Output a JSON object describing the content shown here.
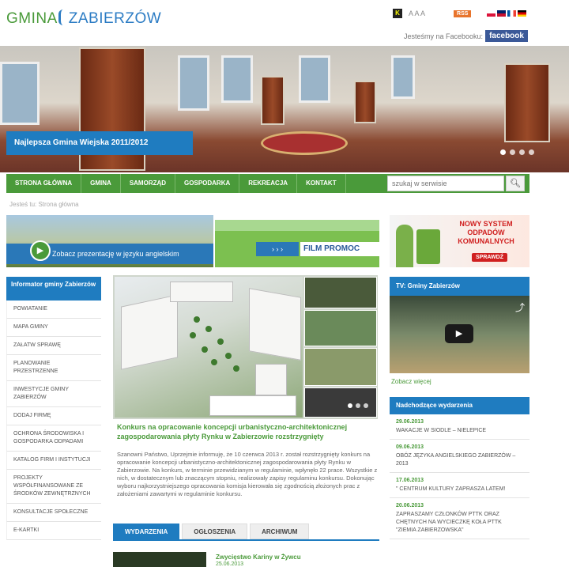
{
  "header": {
    "logo_gmina": "GMINA",
    "logo_name": "ZABIERZÓW",
    "contrast_label": "K",
    "font_size_label": "A A A",
    "rss_label": "RSS",
    "facebook_prompt": "Jesteśmy na Facebooku:",
    "facebook_label": "facebook",
    "flags": [
      {
        "name": "polish-flag-icon",
        "colors": [
          "#ffffff",
          "#dc143c"
        ]
      },
      {
        "name": "english-flag-icon",
        "colors": [
          "#012169",
          "#c8102e"
        ]
      },
      {
        "name": "french-flag-icon",
        "colors": [
          "#0055a4",
          "#ffffff",
          "#ef4135"
        ]
      },
      {
        "name": "german-flag-icon",
        "colors": [
          "#000000",
          "#dd0000",
          "#ffce00"
        ]
      }
    ]
  },
  "hero": {
    "caption": "Najlepsza Gmina Wiejska 2011/2012",
    "slide_count": 4,
    "active_slide": 1
  },
  "nav": {
    "items": [
      "STRONA GŁÓWNA",
      "GMINA",
      "SAMORZĄD",
      "GOSPODARKA",
      "REKREACJA",
      "KONTAKT"
    ],
    "search_placeholder": "szukaj w serwisie"
  },
  "breadcrumb": "Jesteś tu: Strona główna",
  "banners": {
    "presentation": "Zobacz prezentację w języku angielskim",
    "film_arrows": "› › ›",
    "film_label": "FILM PROMOC",
    "waste_text": "NOWY SYSTEM ODPADÓW KOMUNALNYCH",
    "waste_button": "SPRAWDŹ"
  },
  "sidebar": {
    "title": "Informator gminy Zabierzów",
    "items": [
      "POWIATANIE",
      "MAPA GMINY",
      "ZAŁATW SPRAWĘ",
      "PLANOWANIE PRZESTRZENNE",
      "INWESTYCJE GMINY ZABIERZÓW",
      "DODAJ FIRMĘ",
      "OCHRONA ŚRODOWISKA I GOSPODARKA ODPADAMI",
      "KATALOG FIRM I INSTYTUCJI",
      "PROJEKTY WSPÓŁFINANSOWANE ZE ŚRODKÓW ZEWNĘTRZNYCH",
      "KONSULTACJE SPOŁECZNE",
      "E-KARTKI"
    ]
  },
  "feature": {
    "title": "Konkurs na opracowanie koncepcji urbanistyczno-architektonicznej zagospodarowania płyty Rynku w Zabierzowie rozstrzygnięty",
    "text": "Szanowni Państwo, Uprzejmie informuję, że 10 czerwca 2013 r. został rozstrzygnięty konkurs na opracowanie koncepcji urbanistyczno-architektonicznej zagospodarowania płyty Rynku w Zabierzowie. Na konkurs, w terminie przewidzianym w regulaminie, wpłynęło 22 prace. Wszystkie z nich, w dostatecznym lub znaczącym stopniu, realizowały zapisy regulaminu konkursu. Dokonując wyboru najkorzystniejszego opracowania komisja kierowała się zgodnością złożonych prac z założeniami zawartymi w regulaminie konkursu.",
    "slide_count": 3,
    "active_slide": 1
  },
  "tabs": [
    "WYDARZENIA",
    "OGŁOSZENIA",
    "ARCHIWUM"
  ],
  "news": {
    "title": "Zwycięstwo Kariny w Żywcu",
    "date": "25.06.2013"
  },
  "tv": {
    "title": "TV: Gminy Zabierzów",
    "more": "Zobacz więcej"
  },
  "events": {
    "title": "Nadchodzące wydarzenia",
    "items": [
      {
        "date": "29.06.2013",
        "title": "WAKACJE W SIODLE – NIELEPICE"
      },
      {
        "date": "09.06.2013",
        "title": "OBÓZ JĘZYKA ANGIELSKIEGO ZABIERZÓW – 2013"
      },
      {
        "date": "17.06.2013",
        "title": "\" CENTRUM KULTURY ZAPRASZA LATEM!"
      },
      {
        "date": "20.06.2013",
        "title": "ZAPRASZAMY CZŁONKÓW PTTK ORAZ CHĘTNYCH NA WYCIECZKĘ KOŁA PTTK \"ZIEMIA ZABIERZOWSKA\""
      }
    ]
  },
  "colors": {
    "brand_green": "#4a9a3a",
    "brand_blue": "#1f7cc0"
  }
}
